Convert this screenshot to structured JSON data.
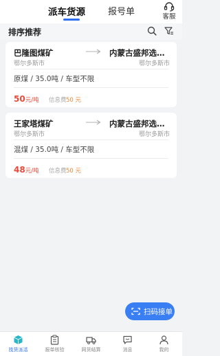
{
  "header": {
    "tabs": [
      {
        "label": "派车货源",
        "active": true
      },
      {
        "label": "报号单",
        "active": false
      }
    ],
    "service_label": "客服"
  },
  "sortbar": {
    "title": "排序推荐",
    "icons": [
      "search-icon",
      "filter-icon"
    ]
  },
  "cards": [
    {
      "from": "巴隆图煤矿",
      "from_city": "鄂尔多斯市",
      "to": "内蒙古盛邦选煤有限公司",
      "to_city": "鄂尔多斯市",
      "spec": "原煤 / 35.0吨 / 车型不限",
      "price": "50",
      "price_unit": "元/吨",
      "fee_label": "信息费",
      "fee_value": "50 元"
    },
    {
      "from": "王家塔煤矿",
      "from_city": "鄂尔多斯市",
      "to": "内蒙古盛邦选煤有限公司",
      "to_city": "鄂尔多斯市",
      "spec": "混煤 / 35.0吨 / 车型不限",
      "price": "48",
      "price_unit": "元/吨",
      "fee_label": "信息费",
      "fee_value": "50 元"
    }
  ],
  "scan_button": {
    "label": "扫码接单",
    "icon": "scan-icon"
  },
  "bottom_nav": [
    {
      "label": "找货派活",
      "icon": "cube-icon",
      "active": true
    },
    {
      "label": "报单核验",
      "icon": "clipboard-icon",
      "active": false
    },
    {
      "label": "网货结算",
      "icon": "truck-icon",
      "active": false
    },
    {
      "label": "消息",
      "icon": "message-icon",
      "active": false
    },
    {
      "label": "我的",
      "icon": "user-icon",
      "active": false
    }
  ],
  "colors": {
    "accent": "#2b6ff0",
    "price": "#e84a3a",
    "fee": "#e8893a",
    "background": "#f2f3f5"
  }
}
